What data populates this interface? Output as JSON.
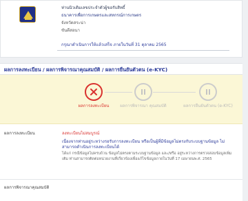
{
  "header": {
    "address_lines": [
      "ห่านนิวเดิมเลขประจำตัวผู้ขอรับสิทธิ์",
      "ธนาคารเพื่อการเกษตรและสหกรณ์การเกษตร",
      "จังหวัดสระน่า",
      "ขันดีสอนา"
    ],
    "deadline": "กรุณาดำเนินการให้แล้วเสร็จ ภายในวันที่ 31 ตุลาคม 2565"
  },
  "status": {
    "title": "ผลการลงทะเบียน / ผลการพิจารณาคุณสมบัติ / ผลการยืนยันตัวตน (e-KYC)",
    "steps": [
      {
        "label": "ผลการลงทะเบียน",
        "state": "error",
        "icon": "x-icon"
      },
      {
        "label": "ผลการพิจารณา คุณสมบัติ",
        "state": "pending",
        "icon": "pause-icon"
      },
      {
        "label": "ผลการยืนยันตัวตน (e-KYC)",
        "state": "pending",
        "icon": "pause-icon"
      }
    ]
  },
  "details": {
    "registration_label": "ผลการลงทะเบียน",
    "result_title": "ลงทะเบียนไม่สมบูรณ์",
    "result_blue": "เนื่องจากท่านอยู่ระหว่างรอรับการลงทะเบียน หรือเป็นผู้ที่มีข้อมูลไม่ตรงกับระบบฐานข้อมูล ไม่สามารถดำเนินการลงทะเบียนได้",
    "result_note": "ได้แก่ กรณีข้อมูลไม่ครบถ้วน ข้อมูลไม่ตรงตามระบบฐานข้อมูล และ/หรือ อยู่ระหว่างการตรวจสอบข้อมูลเพิ่มเติม ท่านสามารถติดต่อหน่วยงานที่เกี่ยวข้องเพื่อแก้ไขข้อมูลภายในวันที่ 17 เมษายนพ.ศ. 2565",
    "qualification_label": "ผลการพิจารณาคุณสมบัติ"
  },
  "colors": {
    "accent": "#2a3a98",
    "error": "#d9322f",
    "pending": "#cccccc",
    "panel": "#fbf7d6"
  }
}
